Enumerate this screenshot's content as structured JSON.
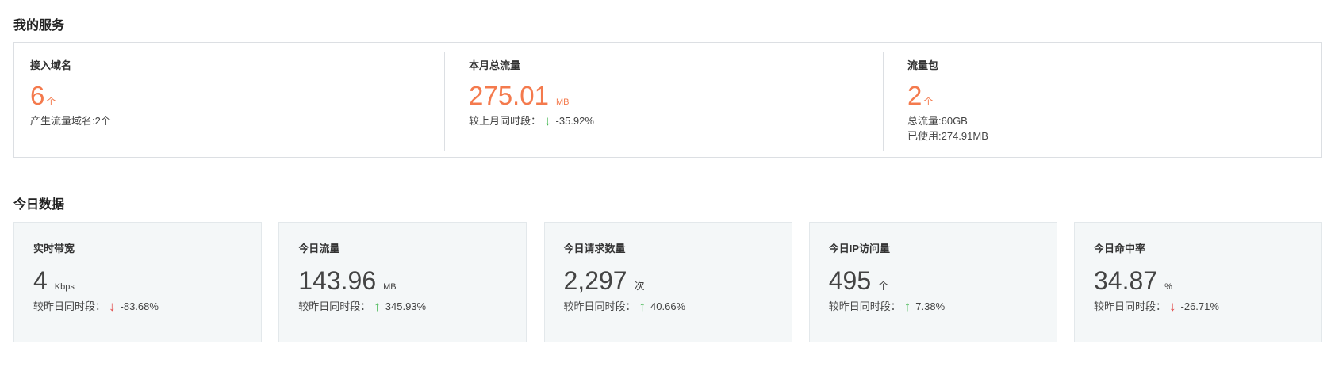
{
  "section_services": {
    "title": "我的服务"
  },
  "services": [
    {
      "label": "接入域名",
      "value": "6",
      "unit": "个",
      "lines": [
        "产生流量域名:2个"
      ]
    },
    {
      "label": "本月总流量",
      "value": "275.01",
      "unit": "MB",
      "compare_label": "较上月同时段：",
      "trend": "down",
      "change": "-35.92%"
    },
    {
      "label": "流量包",
      "value": "2",
      "unit": "个",
      "lines": [
        "总流量:60GB",
        "已使用:274.91MB"
      ]
    }
  ],
  "section_today": {
    "title": "今日数据"
  },
  "today": [
    {
      "label": "实时带宽",
      "value": "4",
      "unit": "Kbps",
      "compare_label": "较昨日同时段：",
      "trend": "down",
      "change": "-83.68%"
    },
    {
      "label": "今日流量",
      "value": "143.96",
      "unit": "MB",
      "compare_label": "较昨日同时段：",
      "trend": "up",
      "change": "345.93%"
    },
    {
      "label": "今日请求数量",
      "value": "2,297",
      "unit": "次",
      "compare_label": "较昨日同时段：",
      "trend": "up",
      "change": "40.66%"
    },
    {
      "label": "今日IP访问量",
      "value": "495",
      "unit": "个",
      "compare_label": "较昨日同时段：",
      "trend": "up",
      "change": "7.38%"
    },
    {
      "label": "今日命中率",
      "value": "34.87",
      "unit": "%",
      "compare_label": "较昨日同时段：",
      "trend": "down",
      "change": "-26.71%"
    }
  ],
  "icons": {
    "arrow_up": "↑",
    "arrow_down": "↓"
  },
  "colors": {
    "accent": "#f47a4d",
    "up": "#3ab449",
    "down_green": "#3ab449",
    "down_red": "#e24a4a"
  }
}
